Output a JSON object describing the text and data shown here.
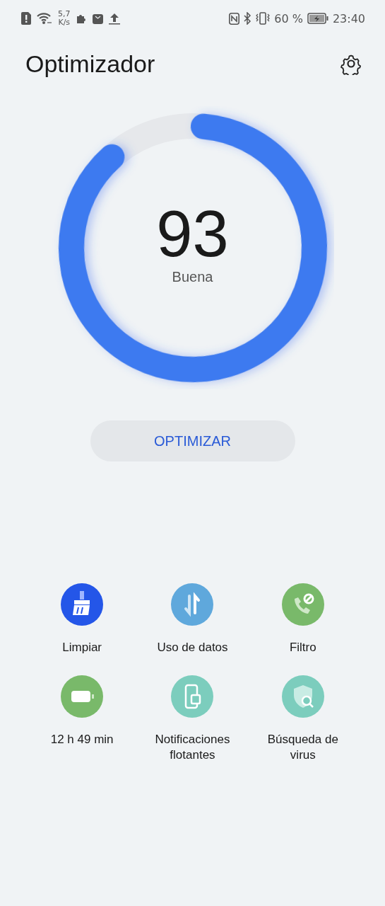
{
  "status_bar": {
    "speed_value": "5,7",
    "speed_unit": "K/s",
    "battery": "60 %",
    "time": "23:40"
  },
  "header": {
    "title": "Optimizador"
  },
  "score": {
    "value": "93",
    "label": "Buena"
  },
  "optimize_button": {
    "label": "OPTIMIZAR"
  },
  "tools": [
    {
      "kind": "clean",
      "label": "Limpiar",
      "color": "#2456e8"
    },
    {
      "kind": "data",
      "label": "Uso de datos",
      "color": "#5fa8dc"
    },
    {
      "kind": "filter",
      "label": "Filtro",
      "color": "#79b96a"
    },
    {
      "kind": "battery",
      "label": "12 h 49 min",
      "color": "#79b96a"
    },
    {
      "kind": "floating",
      "label": "Notificaciones flotantes",
      "color": "#7ccdbd"
    },
    {
      "kind": "virus",
      "label": "Búsqueda de virus",
      "color": "#7ccdbd"
    }
  ]
}
